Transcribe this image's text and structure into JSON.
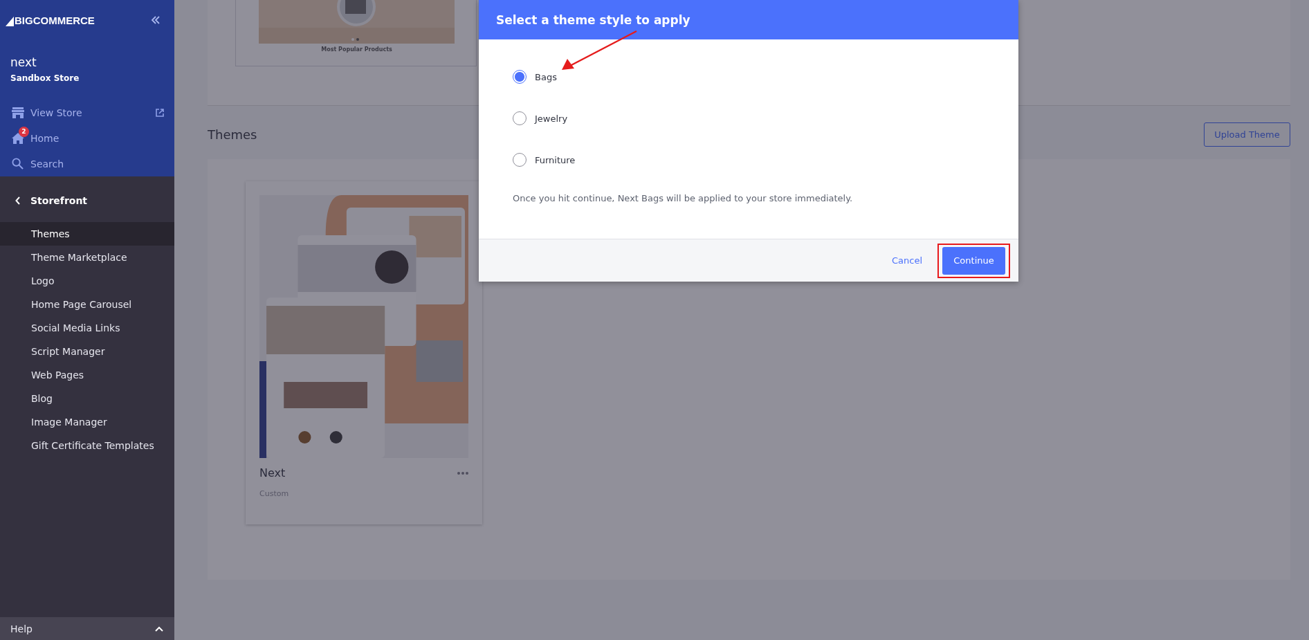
{
  "sidebar": {
    "logo": {
      "prefix": "BIG",
      "suffix": "COMMERCE"
    },
    "store_name": "next",
    "store_type": "Sandbox Store",
    "nav": [
      {
        "label": "View Store",
        "kind": "store",
        "external": true
      },
      {
        "label": "Home",
        "kind": "home",
        "badge": "2"
      },
      {
        "label": "Search",
        "kind": "search"
      }
    ],
    "section": "Storefront",
    "items": [
      {
        "label": "Themes",
        "selected": true
      },
      {
        "label": "Theme Marketplace",
        "selected": false
      },
      {
        "label": "Logo",
        "selected": false
      },
      {
        "label": "Home Page Carousel",
        "selected": false
      },
      {
        "label": "Social Media Links",
        "selected": false
      },
      {
        "label": "Script Manager",
        "selected": false
      },
      {
        "label": "Web Pages",
        "selected": false
      },
      {
        "label": "Blog",
        "selected": false
      },
      {
        "label": "Image Manager",
        "selected": false
      },
      {
        "label": "Gift Certificate Templates",
        "selected": false
      }
    ],
    "help": "Help"
  },
  "main": {
    "preview_caption": "Most Popular Products",
    "section_title": "Themes",
    "upload_button": "Upload Theme",
    "theme_card": {
      "name": "Next",
      "type": "Custom"
    }
  },
  "dialog": {
    "title": "Select a theme style to apply",
    "options": [
      {
        "label": "Bags",
        "selected": true
      },
      {
        "label": "Jewelry",
        "selected": false
      },
      {
        "label": "Furniture",
        "selected": false
      }
    ],
    "note": "Once you hit continue, Next Bags will be applied to your store immediately.",
    "cancel": "Cancel",
    "confirm": "Continue"
  }
}
